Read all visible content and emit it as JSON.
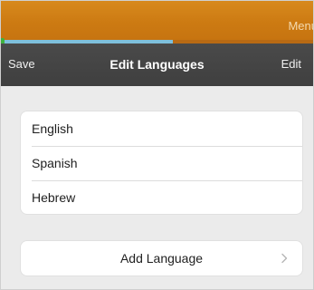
{
  "top_bar": {
    "menu_label": "Menu",
    "progress_fraction": 0.55,
    "progress_color": "#7ec0dc",
    "bar_color": "#d88a1e"
  },
  "nav_bar": {
    "left_label": "Save",
    "title": "Edit Languages",
    "right_label": "Edit"
  },
  "languages": [
    {
      "label": "English"
    },
    {
      "label": "Spanish"
    },
    {
      "label": "Hebrew"
    }
  ],
  "add_language": {
    "label": "Add Language",
    "icon": "chevron-right-icon"
  }
}
